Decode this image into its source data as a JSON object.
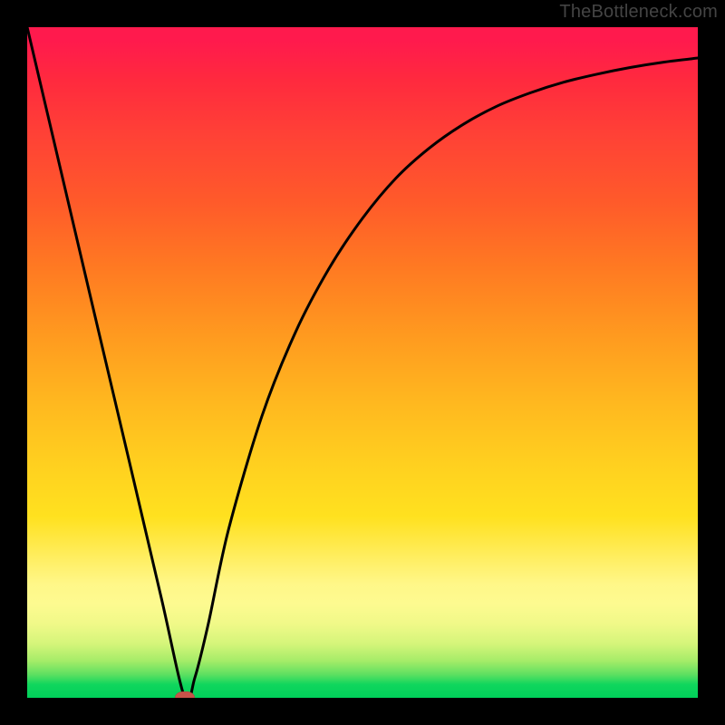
{
  "watermark": "TheBottleneck.com",
  "colors": {
    "background": "#000000",
    "curve": "#000000",
    "marker": "#c9534a"
  },
  "chart_data": {
    "type": "line",
    "title": "",
    "xlabel": "",
    "ylabel": "",
    "xlim": [
      0,
      100
    ],
    "ylim": [
      0,
      100
    ],
    "gradient_stops": [
      {
        "pos": 0,
        "color": "#ff1a4d"
      },
      {
        "pos": 16,
        "color": "#ff4136"
      },
      {
        "pos": 36,
        "color": "#ff7a22"
      },
      {
        "pos": 56,
        "color": "#ffb81f"
      },
      {
        "pos": 73,
        "color": "#ffe11f"
      },
      {
        "pos": 86,
        "color": "#fdfa90"
      },
      {
        "pos": 94.5,
        "color": "#a5ec68"
      },
      {
        "pos": 100,
        "color": "#00d05a"
      }
    ],
    "series": [
      {
        "name": "bottleneck-curve",
        "x": [
          0,
          5,
          10,
          15,
          20,
          23.5,
          25,
          27,
          30,
          35,
          40,
          45,
          50,
          55,
          60,
          65,
          70,
          75,
          80,
          85,
          90,
          95,
          100
        ],
        "y": [
          100,
          78.7,
          57.4,
          36.2,
          14.9,
          0.0,
          3.0,
          11.0,
          25.0,
          42.0,
          54.5,
          64.0,
          71.5,
          77.5,
          82.0,
          85.5,
          88.2,
          90.2,
          91.8,
          93.0,
          94.0,
          94.8,
          95.4
        ]
      }
    ],
    "marker": {
      "x": 23.5,
      "y": 0.0
    }
  }
}
